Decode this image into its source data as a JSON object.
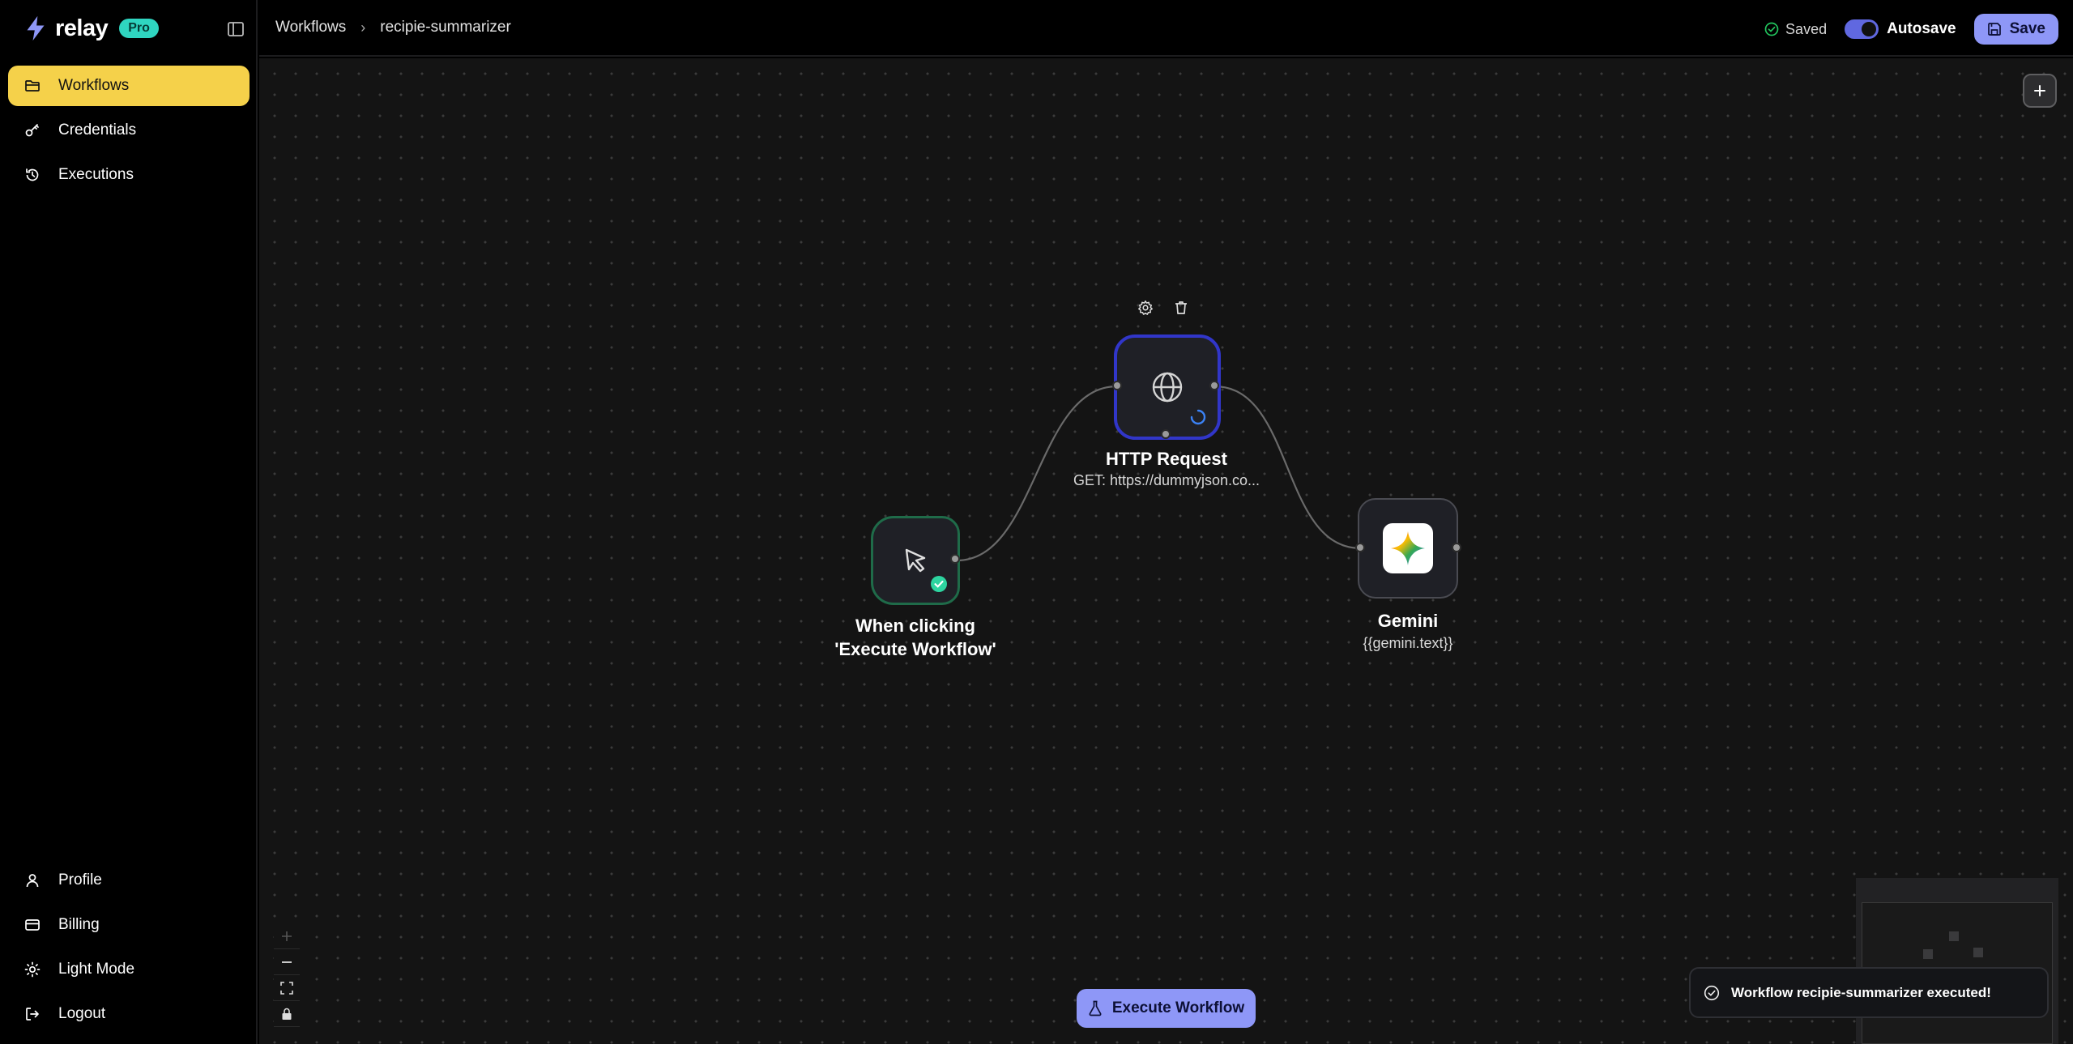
{
  "brand": {
    "name": "relay",
    "badge": "Pro"
  },
  "sidebar": {
    "top_items": [
      {
        "label": "Workflows",
        "icon": "folder-icon",
        "active": true
      },
      {
        "label": "Credentials",
        "icon": "key-icon"
      },
      {
        "label": "Executions",
        "icon": "history-icon"
      }
    ],
    "bottom_items": [
      {
        "label": "Profile",
        "icon": "user-icon"
      },
      {
        "label": "Billing",
        "icon": "credit-card-icon"
      },
      {
        "label": "Light Mode",
        "icon": "sun-icon"
      },
      {
        "label": "Logout",
        "icon": "logout-icon"
      }
    ]
  },
  "header": {
    "breadcrumb": [
      "Workflows",
      "recipie-summarizer"
    ],
    "saved_label": "Saved",
    "autosave_label": "Autosave",
    "autosave_on": true,
    "save_label": "Save"
  },
  "nodes": {
    "trigger": {
      "title": "When clicking 'Execute Workflow'",
      "status": "success"
    },
    "http": {
      "title": "HTTP Request",
      "subtitle": "GET: https://dummyjson.co...",
      "status": "running"
    },
    "gemini": {
      "title": "Gemini",
      "subtitle": "{{gemini.text}}"
    }
  },
  "execute_label": "Execute Workflow",
  "toast": {
    "message": "Workflow recipie-summarizer executed!"
  },
  "colors": {
    "accent": "#8e97f7",
    "active_nav": "#f5d14a",
    "pro_badge": "#2fd5c0",
    "success": "#22c55e",
    "running": "#3136c9"
  }
}
